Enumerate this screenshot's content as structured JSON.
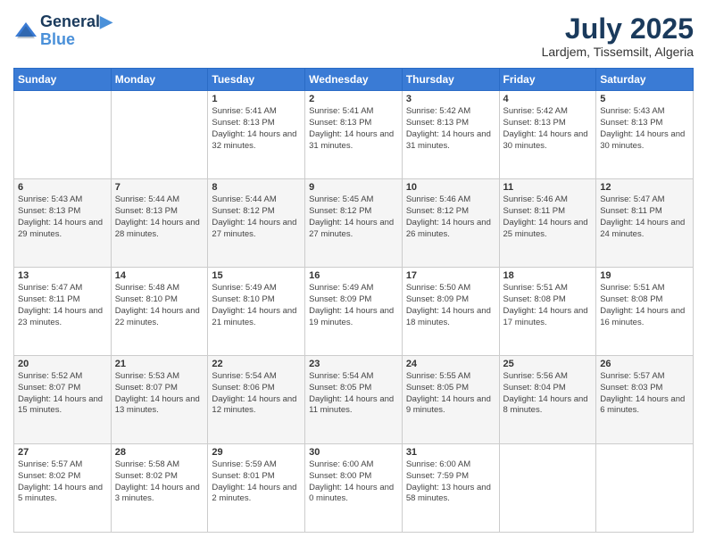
{
  "header": {
    "logo_line1": "General",
    "logo_line2": "Blue",
    "month_year": "July 2025",
    "location": "Lardjem, Tissemsilt, Algeria"
  },
  "days_of_week": [
    "Sunday",
    "Monday",
    "Tuesday",
    "Wednesday",
    "Thursday",
    "Friday",
    "Saturday"
  ],
  "weeks": [
    [
      {
        "day": "",
        "sunrise": "",
        "sunset": "",
        "daylight": ""
      },
      {
        "day": "",
        "sunrise": "",
        "sunset": "",
        "daylight": ""
      },
      {
        "day": "1",
        "sunrise": "Sunrise: 5:41 AM",
        "sunset": "Sunset: 8:13 PM",
        "daylight": "Daylight: 14 hours and 32 minutes."
      },
      {
        "day": "2",
        "sunrise": "Sunrise: 5:41 AM",
        "sunset": "Sunset: 8:13 PM",
        "daylight": "Daylight: 14 hours and 31 minutes."
      },
      {
        "day": "3",
        "sunrise": "Sunrise: 5:42 AM",
        "sunset": "Sunset: 8:13 PM",
        "daylight": "Daylight: 14 hours and 31 minutes."
      },
      {
        "day": "4",
        "sunrise": "Sunrise: 5:42 AM",
        "sunset": "Sunset: 8:13 PM",
        "daylight": "Daylight: 14 hours and 30 minutes."
      },
      {
        "day": "5",
        "sunrise": "Sunrise: 5:43 AM",
        "sunset": "Sunset: 8:13 PM",
        "daylight": "Daylight: 14 hours and 30 minutes."
      }
    ],
    [
      {
        "day": "6",
        "sunrise": "Sunrise: 5:43 AM",
        "sunset": "Sunset: 8:13 PM",
        "daylight": "Daylight: 14 hours and 29 minutes."
      },
      {
        "day": "7",
        "sunrise": "Sunrise: 5:44 AM",
        "sunset": "Sunset: 8:13 PM",
        "daylight": "Daylight: 14 hours and 28 minutes."
      },
      {
        "day": "8",
        "sunrise": "Sunrise: 5:44 AM",
        "sunset": "Sunset: 8:12 PM",
        "daylight": "Daylight: 14 hours and 27 minutes."
      },
      {
        "day": "9",
        "sunrise": "Sunrise: 5:45 AM",
        "sunset": "Sunset: 8:12 PM",
        "daylight": "Daylight: 14 hours and 27 minutes."
      },
      {
        "day": "10",
        "sunrise": "Sunrise: 5:46 AM",
        "sunset": "Sunset: 8:12 PM",
        "daylight": "Daylight: 14 hours and 26 minutes."
      },
      {
        "day": "11",
        "sunrise": "Sunrise: 5:46 AM",
        "sunset": "Sunset: 8:11 PM",
        "daylight": "Daylight: 14 hours and 25 minutes."
      },
      {
        "day": "12",
        "sunrise": "Sunrise: 5:47 AM",
        "sunset": "Sunset: 8:11 PM",
        "daylight": "Daylight: 14 hours and 24 minutes."
      }
    ],
    [
      {
        "day": "13",
        "sunrise": "Sunrise: 5:47 AM",
        "sunset": "Sunset: 8:11 PM",
        "daylight": "Daylight: 14 hours and 23 minutes."
      },
      {
        "day": "14",
        "sunrise": "Sunrise: 5:48 AM",
        "sunset": "Sunset: 8:10 PM",
        "daylight": "Daylight: 14 hours and 22 minutes."
      },
      {
        "day": "15",
        "sunrise": "Sunrise: 5:49 AM",
        "sunset": "Sunset: 8:10 PM",
        "daylight": "Daylight: 14 hours and 21 minutes."
      },
      {
        "day": "16",
        "sunrise": "Sunrise: 5:49 AM",
        "sunset": "Sunset: 8:09 PM",
        "daylight": "Daylight: 14 hours and 19 minutes."
      },
      {
        "day": "17",
        "sunrise": "Sunrise: 5:50 AM",
        "sunset": "Sunset: 8:09 PM",
        "daylight": "Daylight: 14 hours and 18 minutes."
      },
      {
        "day": "18",
        "sunrise": "Sunrise: 5:51 AM",
        "sunset": "Sunset: 8:08 PM",
        "daylight": "Daylight: 14 hours and 17 minutes."
      },
      {
        "day": "19",
        "sunrise": "Sunrise: 5:51 AM",
        "sunset": "Sunset: 8:08 PM",
        "daylight": "Daylight: 14 hours and 16 minutes."
      }
    ],
    [
      {
        "day": "20",
        "sunrise": "Sunrise: 5:52 AM",
        "sunset": "Sunset: 8:07 PM",
        "daylight": "Daylight: 14 hours and 15 minutes."
      },
      {
        "day": "21",
        "sunrise": "Sunrise: 5:53 AM",
        "sunset": "Sunset: 8:07 PM",
        "daylight": "Daylight: 14 hours and 13 minutes."
      },
      {
        "day": "22",
        "sunrise": "Sunrise: 5:54 AM",
        "sunset": "Sunset: 8:06 PM",
        "daylight": "Daylight: 14 hours and 12 minutes."
      },
      {
        "day": "23",
        "sunrise": "Sunrise: 5:54 AM",
        "sunset": "Sunset: 8:05 PM",
        "daylight": "Daylight: 14 hours and 11 minutes."
      },
      {
        "day": "24",
        "sunrise": "Sunrise: 5:55 AM",
        "sunset": "Sunset: 8:05 PM",
        "daylight": "Daylight: 14 hours and 9 minutes."
      },
      {
        "day": "25",
        "sunrise": "Sunrise: 5:56 AM",
        "sunset": "Sunset: 8:04 PM",
        "daylight": "Daylight: 14 hours and 8 minutes."
      },
      {
        "day": "26",
        "sunrise": "Sunrise: 5:57 AM",
        "sunset": "Sunset: 8:03 PM",
        "daylight": "Daylight: 14 hours and 6 minutes."
      }
    ],
    [
      {
        "day": "27",
        "sunrise": "Sunrise: 5:57 AM",
        "sunset": "Sunset: 8:02 PM",
        "daylight": "Daylight: 14 hours and 5 minutes."
      },
      {
        "day": "28",
        "sunrise": "Sunrise: 5:58 AM",
        "sunset": "Sunset: 8:02 PM",
        "daylight": "Daylight: 14 hours and 3 minutes."
      },
      {
        "day": "29",
        "sunrise": "Sunrise: 5:59 AM",
        "sunset": "Sunset: 8:01 PM",
        "daylight": "Daylight: 14 hours and 2 minutes."
      },
      {
        "day": "30",
        "sunrise": "Sunrise: 6:00 AM",
        "sunset": "Sunset: 8:00 PM",
        "daylight": "Daylight: 14 hours and 0 minutes."
      },
      {
        "day": "31",
        "sunrise": "Sunrise: 6:00 AM",
        "sunset": "Sunset: 7:59 PM",
        "daylight": "Daylight: 13 hours and 58 minutes."
      },
      {
        "day": "",
        "sunrise": "",
        "sunset": "",
        "daylight": ""
      },
      {
        "day": "",
        "sunrise": "",
        "sunset": "",
        "daylight": ""
      }
    ]
  ]
}
